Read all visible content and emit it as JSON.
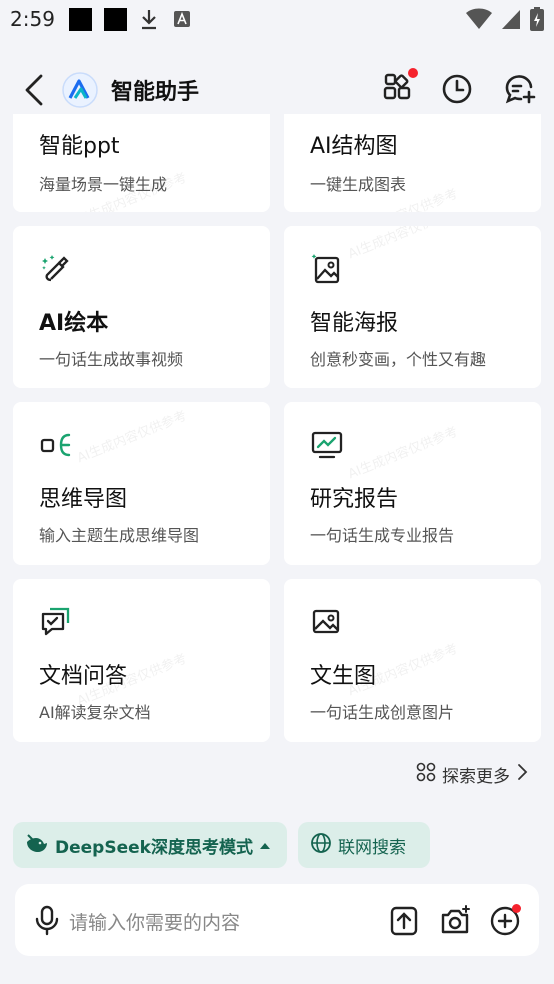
{
  "status_bar": {
    "time": "2:59"
  },
  "header": {
    "title": "智能助手",
    "icons": [
      "back-chevron-icon",
      "app-logo-icon",
      "apps-grid-icon",
      "history-clock-icon",
      "new-chat-icon"
    ],
    "notification_dot_color": "#f5222d"
  },
  "cards": [
    {
      "title": "智能ppt",
      "subtitle": "海量场景一键生成",
      "watermark": "AI生成内容仅供参考"
    },
    {
      "title": "AI结构图",
      "subtitle": "一键生成图表",
      "watermark": "AI生成内容仅供参考"
    },
    {
      "title": "AI绘本",
      "subtitle": "一句话生成故事视频",
      "icon": "magic-brush-icon"
    },
    {
      "title": "智能海报",
      "subtitle": "创意秒变画，个性又有趣",
      "icon": "poster-image-icon",
      "watermark": "AI生成内容仅供参考"
    },
    {
      "title": "思维导图",
      "subtitle": "输入主题生成思维导图",
      "icon": "mind-map-icon",
      "watermark": "AI生成内容仅供参考"
    },
    {
      "title": "研究报告",
      "subtitle": "一句话生成专业报告",
      "icon": "chart-report-icon",
      "watermark": "AI生成内容仅供参考"
    },
    {
      "title": "文档问答",
      "subtitle": "AI解读复杂文档",
      "icon": "doc-chat-icon",
      "watermark": "AI生成内容仅供参考"
    },
    {
      "title": "文生图",
      "subtitle": "一句话生成创意图片",
      "icon": "image-icon",
      "watermark": "AI生成内容仅供参考"
    }
  ],
  "explore": {
    "label": "探索更多"
  },
  "modes": {
    "deepseek": "DeepSeek深度思考模式",
    "web_search": "联网搜索",
    "accent_color": "#14634f",
    "chip_bg": "#dceee9"
  },
  "input": {
    "placeholder": "请输入你需要的内容"
  }
}
